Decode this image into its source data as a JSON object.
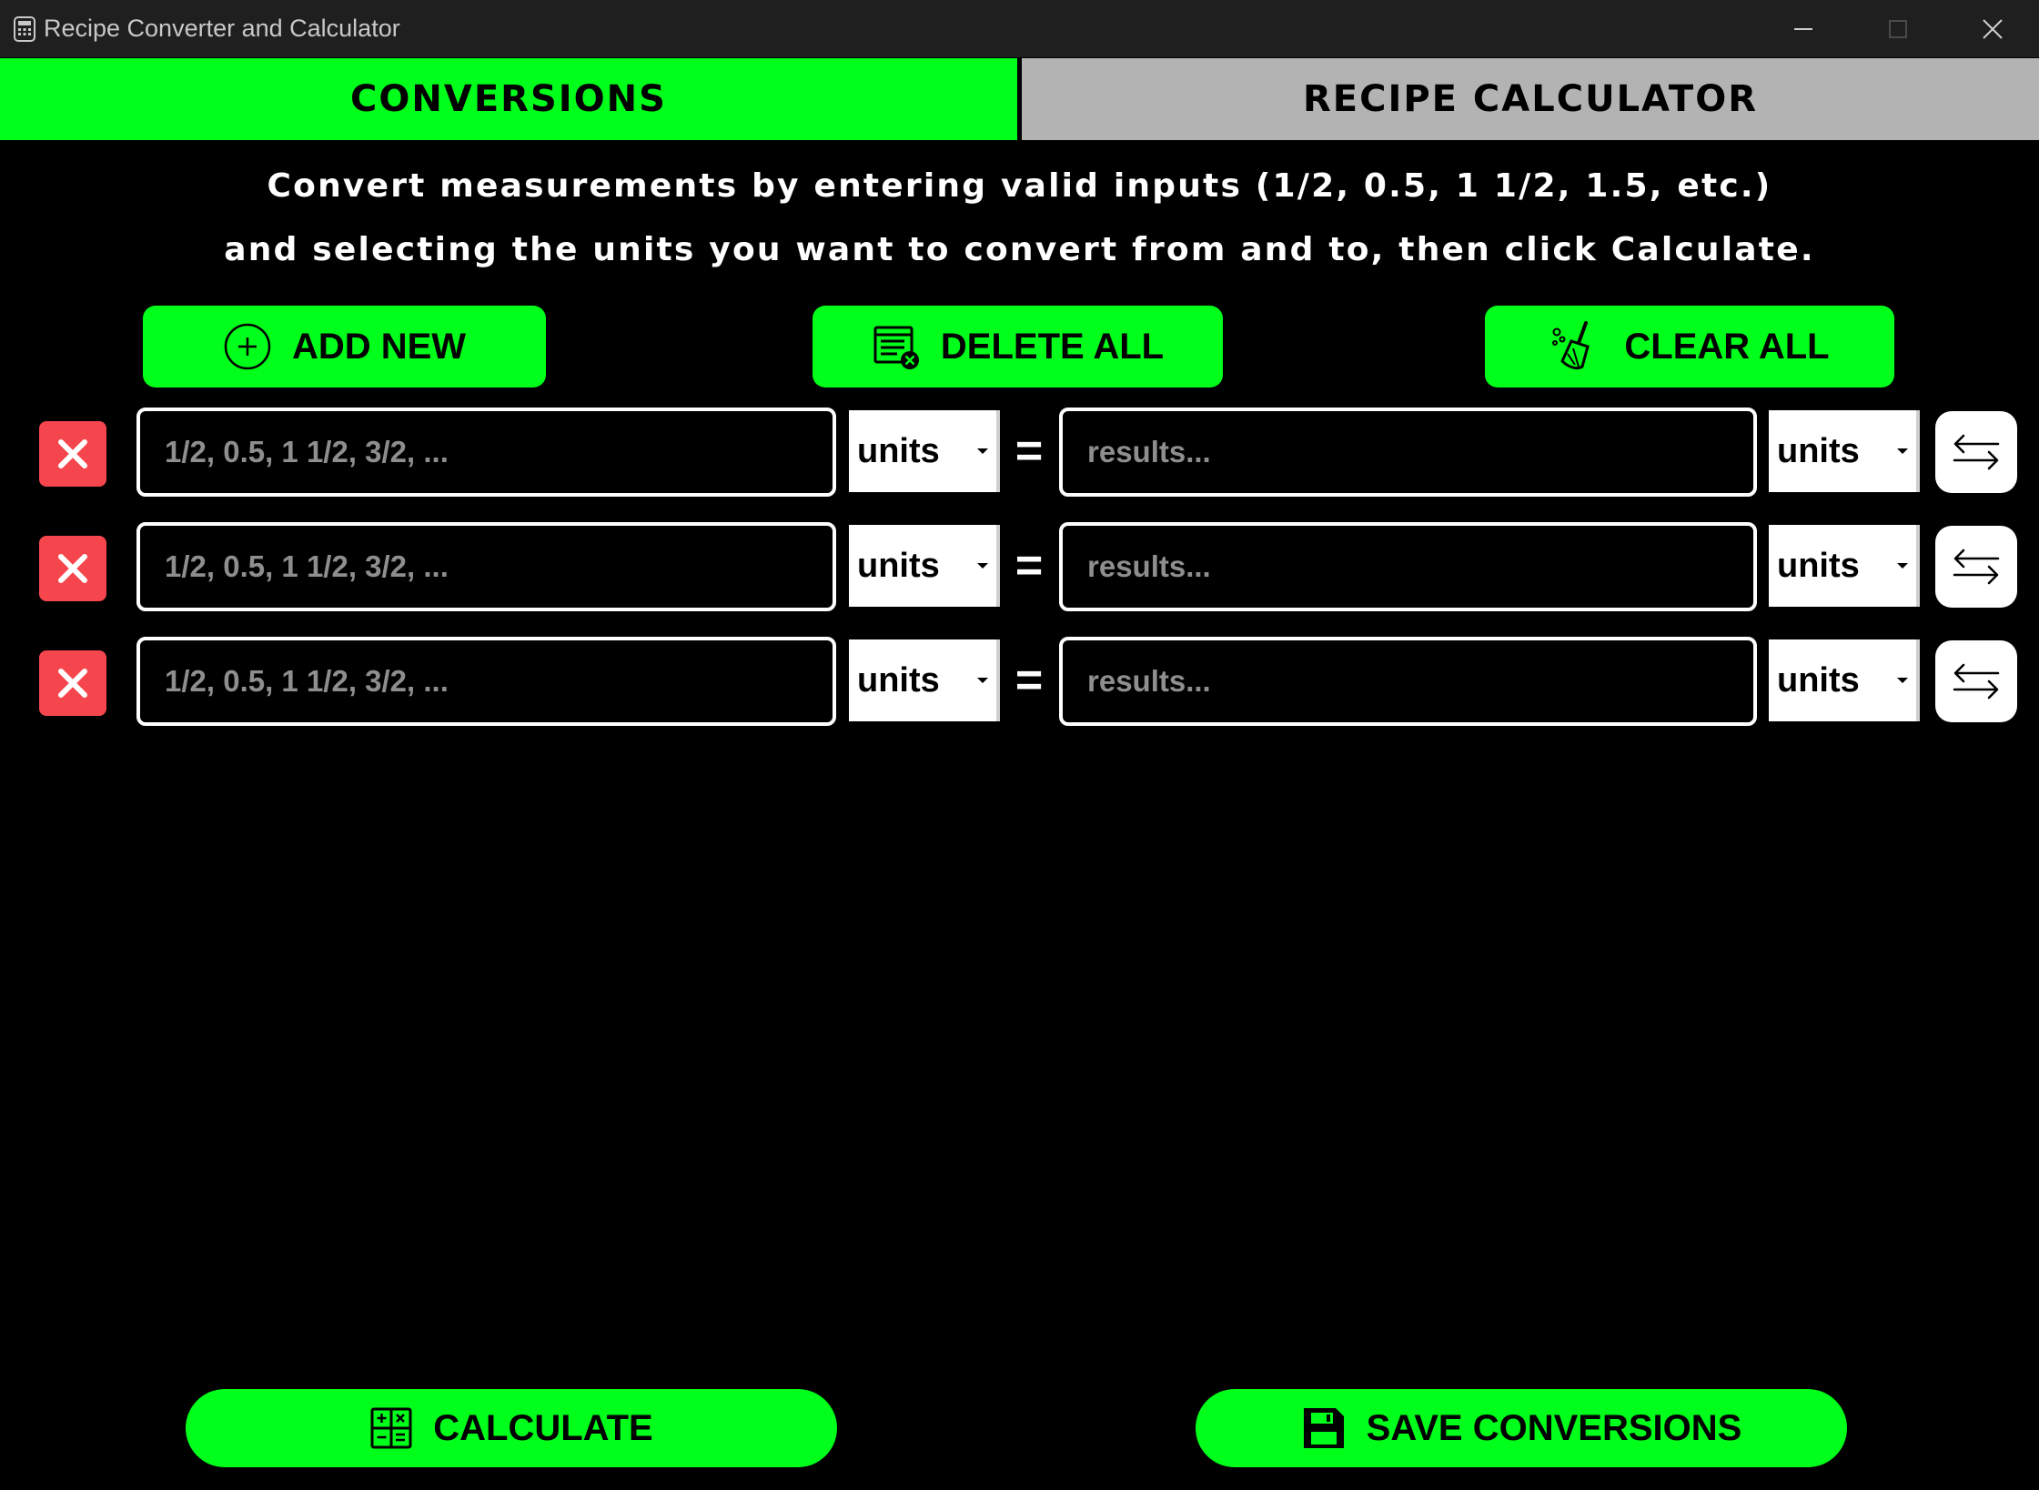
{
  "window": {
    "title": "Recipe Converter and Calculator",
    "icons": {
      "app": "calculator-icon",
      "minimize": "minimize-icon",
      "maximize": "maximize-icon",
      "close": "close-icon"
    }
  },
  "tabs": [
    {
      "label": "CONVERSIONS",
      "active": true
    },
    {
      "label": "RECIPE CALCULATOR",
      "active": false
    }
  ],
  "instructions": {
    "line1": "Convert measurements by entering valid inputs (1/2, 0.5, 1 1/2, 1.5, etc.)",
    "line2": "and selecting the units you want to convert from and to, then click Calculate."
  },
  "actions": {
    "add_new": {
      "label": "ADD NEW",
      "icon": "plus-circle-icon"
    },
    "delete_all": {
      "label": "DELETE ALL",
      "icon": "delete-list-icon"
    },
    "clear_all": {
      "label": "CLEAR ALL",
      "icon": "broom-icon"
    }
  },
  "rows": [
    {
      "input_value": "",
      "input_placeholder": "1/2, 0.5, 1 1/2, 3/2, ...",
      "from_unit": "units",
      "equals": "=",
      "result_value": "",
      "result_placeholder": "results...",
      "to_unit": "units"
    },
    {
      "input_value": "",
      "input_placeholder": "1/2, 0.5, 1 1/2, 3/2, ...",
      "from_unit": "units",
      "equals": "=",
      "result_value": "",
      "result_placeholder": "results...",
      "to_unit": "units"
    },
    {
      "input_value": "",
      "input_placeholder": "1/2, 0.5, 1 1/2, 3/2, ...",
      "from_unit": "units",
      "equals": "=",
      "result_value": "",
      "result_placeholder": "results...",
      "to_unit": "units"
    }
  ],
  "bottom": {
    "calculate": {
      "label": "CALCULATE",
      "icon": "calculator-icon"
    },
    "save": {
      "label": "SAVE CONVERSIONS",
      "icon": "save-floppy-icon"
    }
  },
  "colors": {
    "accent_green": "#00ff1a",
    "inactive_tab": "#b3b3b3",
    "delete_red": "#f5454d",
    "background": "#000000",
    "titlebar": "#1f1f1f"
  }
}
